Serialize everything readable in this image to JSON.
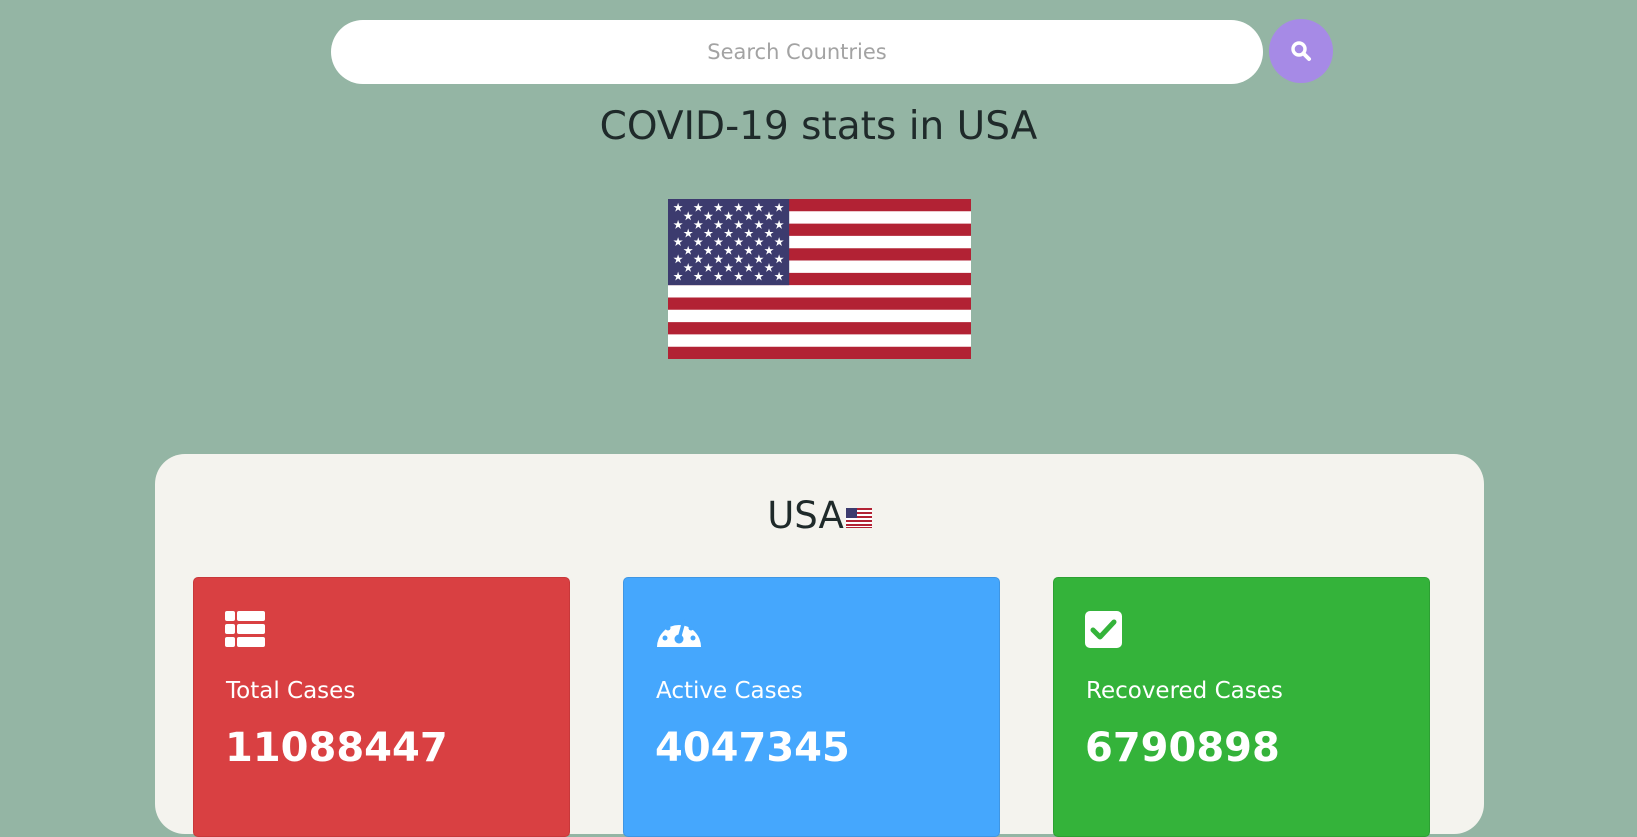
{
  "search": {
    "placeholder": "Search Countries",
    "button_icon": "search-icon"
  },
  "header": {
    "title": "COVID-19 stats in USA",
    "flag_icon": "us-flag-icon"
  },
  "panel": {
    "country": "USA",
    "flag_icon": "us-flag-icon"
  },
  "stats": [
    {
      "label": "Total Cases",
      "value": "11088447",
      "icon": "list-icon",
      "color": "#d94042"
    },
    {
      "label": "Active Cases",
      "value": "4047345",
      "icon": "gauge-icon",
      "color": "#45a7fd"
    },
    {
      "label": "Recovered Cases",
      "value": "6790898",
      "icon": "check-square-icon",
      "color": "#34b33a"
    }
  ],
  "colors": {
    "background": "#94b5a4",
    "panel": "#f4f3ee",
    "search_button": "#a68ae6"
  }
}
